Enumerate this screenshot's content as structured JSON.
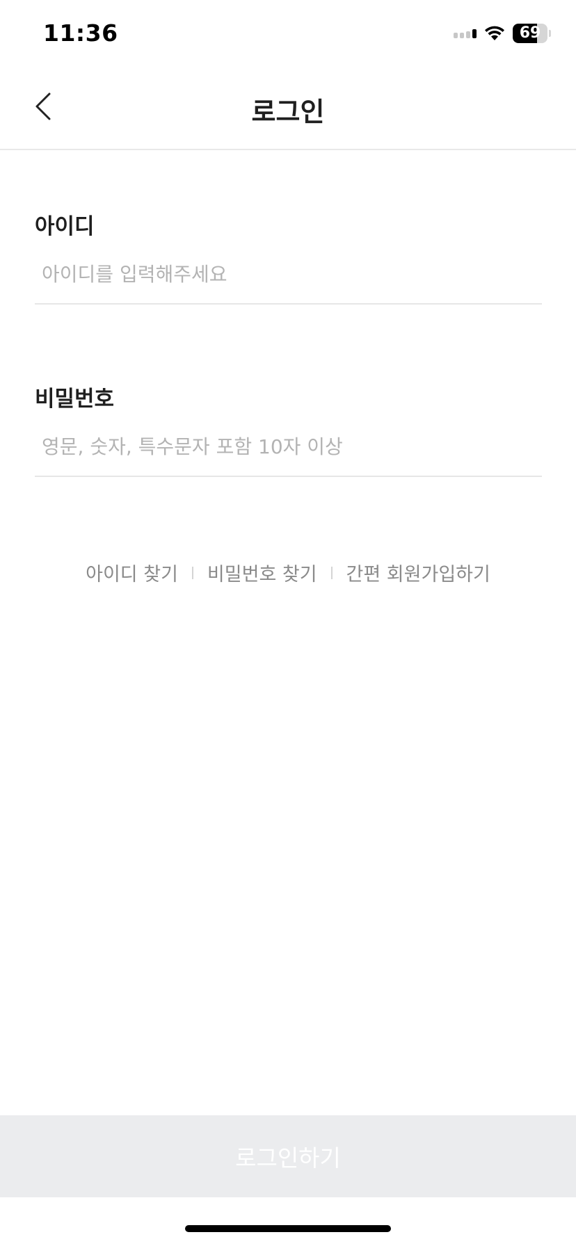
{
  "status_bar": {
    "time": "11:36",
    "battery_level": "69",
    "battery_fraction": 0.69
  },
  "nav": {
    "title": "로그인",
    "back_icon": "chevron-left-icon"
  },
  "form": {
    "id_label": "아이디",
    "id_placeholder": "아이디를 입력해주세요",
    "id_value": "",
    "password_label": "비밀번호",
    "password_placeholder": "영문, 숫자, 특수문자 포함 10자 이상",
    "password_value": ""
  },
  "links": {
    "find_id": "아이디 찾기",
    "find_password": "비밀번호 찾기",
    "signup": "간편 회원가입하기"
  },
  "submit": {
    "label": "로그인하기"
  },
  "colors": {
    "button_disabled_bg": "#ebecee",
    "placeholder": "#b3b3b3",
    "link": "#8a8a8a"
  }
}
